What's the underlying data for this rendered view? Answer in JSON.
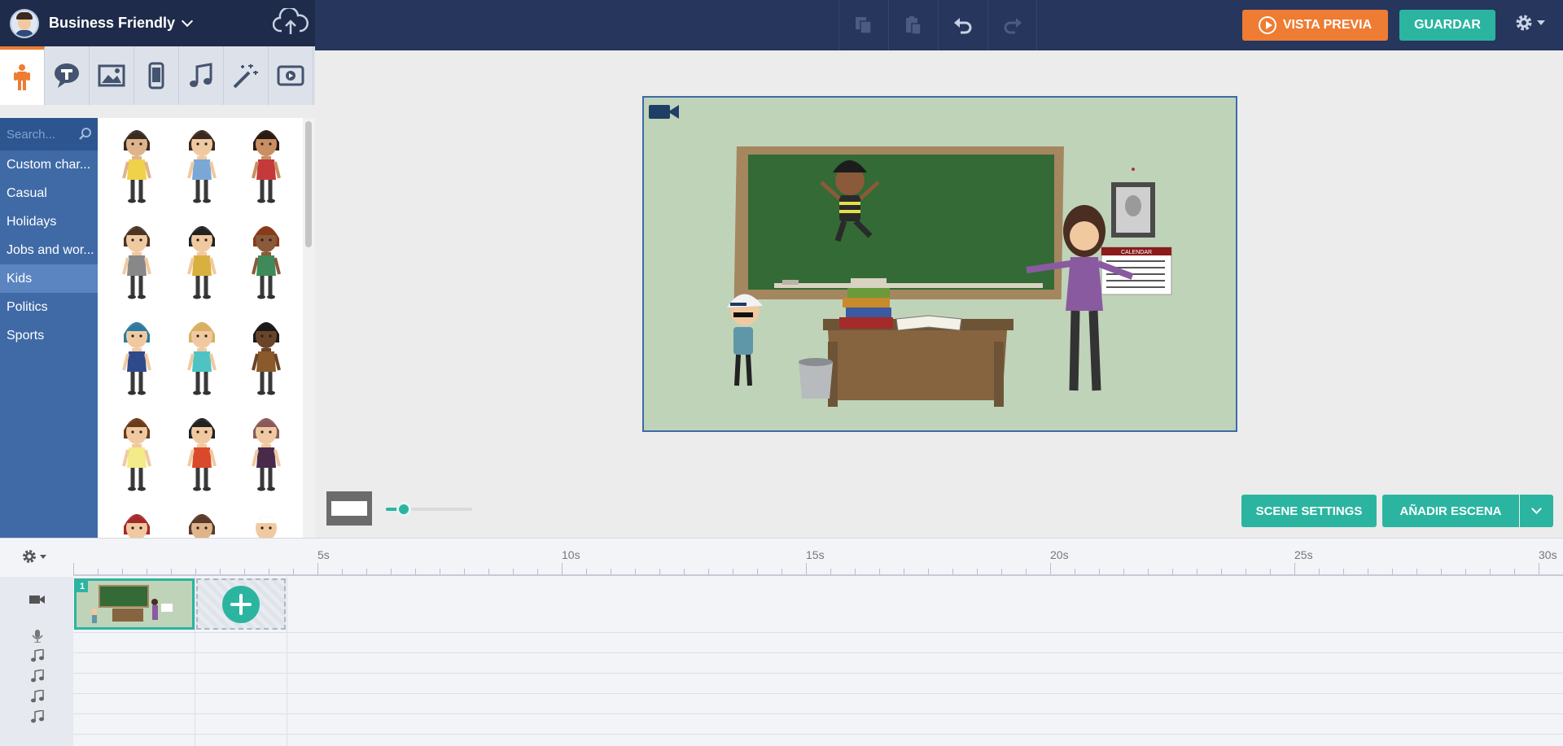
{
  "header": {
    "project_name": "Business Friendly",
    "preview_label": "VISTA PREVIA",
    "save_label": "GUARDAR",
    "toolbar_icons": [
      "copy-icon",
      "paste-icon",
      "undo-icon",
      "redo-icon"
    ],
    "accent_orange": "#ee7c33",
    "accent_teal": "#2bb5a0",
    "bar_color": "#26365c"
  },
  "asset_tabs": [
    "character-icon",
    "speech-bubble-icon",
    "image-icon",
    "device-icon",
    "music-note-icon",
    "magic-wand-icon",
    "video-icon"
  ],
  "sidebar": {
    "search_placeholder": "Search...",
    "items": [
      {
        "label": "Custom char..."
      },
      {
        "label": "Casual"
      },
      {
        "label": "Holidays"
      },
      {
        "label": "Jobs and wor..."
      },
      {
        "label": "Kids",
        "active": true
      },
      {
        "label": "Politics"
      },
      {
        "label": "Sports"
      }
    ]
  },
  "stage": {
    "calendar_text": "CALENDAR"
  },
  "scene_controls": {
    "scene_settings_label": "SCENE SETTINGS",
    "add_scene_label": "AÑADIR ESCENA"
  },
  "timeline": {
    "ticks": [
      "5s",
      "10s",
      "15s",
      "20s",
      "25s",
      "30s"
    ],
    "scene_number": "1",
    "track_icons": [
      "camera-icon",
      "microphone-icon",
      "music-note-icon",
      "music-note-icon",
      "music-note-icon",
      "music-note-icon"
    ]
  }
}
